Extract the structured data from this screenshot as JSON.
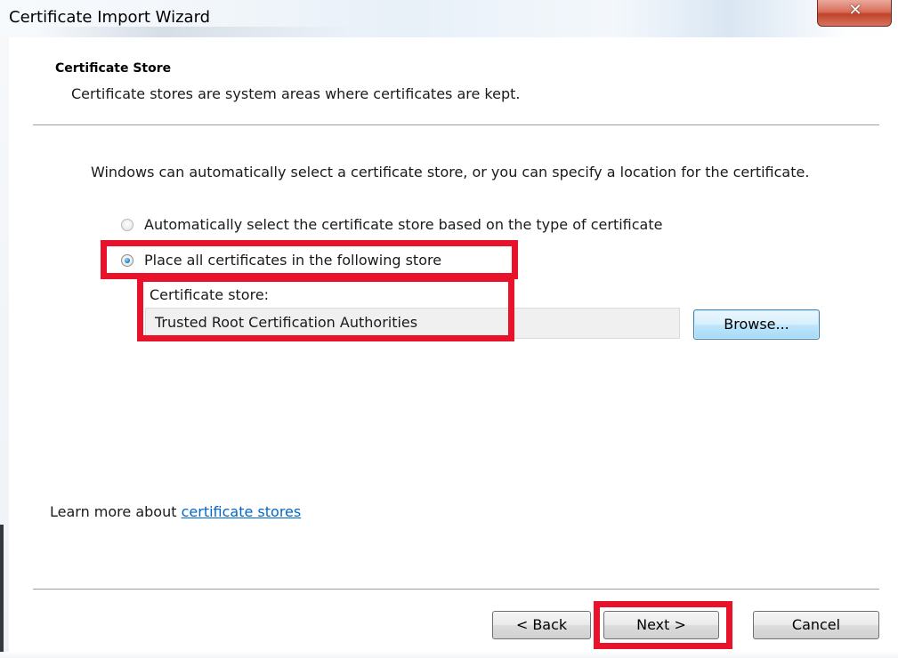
{
  "window": {
    "title": "Certificate Import Wizard",
    "close_glyph": "✕"
  },
  "header": {
    "title": "Certificate Store",
    "description": "Certificate stores are system areas where certificates are kept."
  },
  "body": {
    "intro": "Windows can automatically select a certificate store, or you can specify a location for the certificate.",
    "options": [
      {
        "label": "Automatically select the certificate store based on the type of certificate",
        "selected": false
      },
      {
        "label": "Place all certificates in the following store",
        "selected": true
      }
    ],
    "store_label": "Certificate store:",
    "store_value": "Trusted Root Certification Authorities",
    "browse_label": "Browse..."
  },
  "learn_more": {
    "prefix": "Learn more about ",
    "link": "certificate stores"
  },
  "footer": {
    "back_label": "< Back",
    "next_label": "Next >",
    "cancel_label": "Cancel"
  },
  "colors": {
    "highlight": "#e8132b",
    "link": "#0066cc",
    "radio_selected": "#2a8ad4"
  },
  "icons": {
    "close": "close-icon",
    "radio_selected": "radio-selected-icon",
    "radio_unselected": "radio-unselected-icon"
  }
}
